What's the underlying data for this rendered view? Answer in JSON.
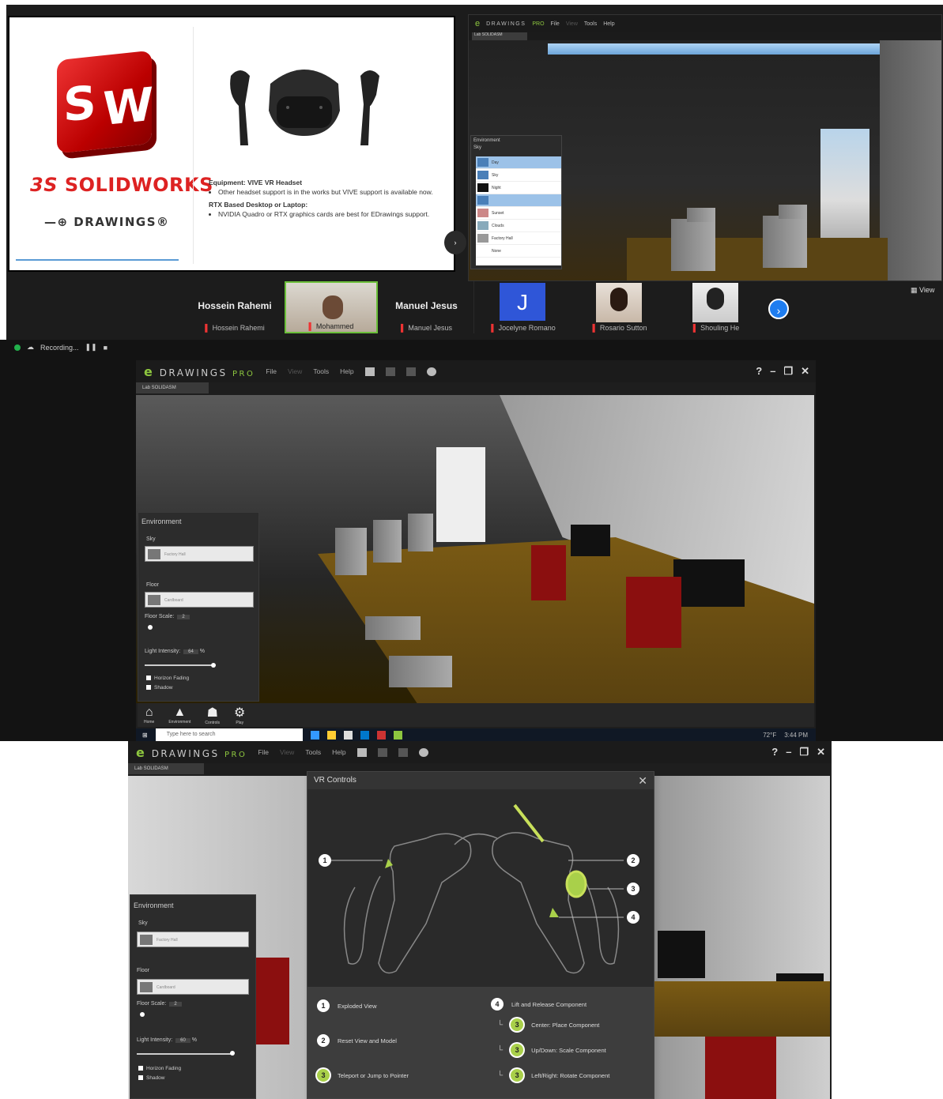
{
  "slide": {
    "sw_letters": [
      "S",
      "W"
    ],
    "brand": "SOLIDWORKS",
    "brand_prefix": "3S",
    "edrawings": "DRAWINGS",
    "equipment_title": "Equipment: VIVE VR Headset",
    "equipment_bullet": "Other headset support is in the works but VIVE support is available now.",
    "rtx_title": "RTX Based Desktop or Laptop:",
    "rtx_bullet": "NVIDIA Quadro or RTX graphics cards are best for EDrawings support.",
    "next_label": "›"
  },
  "participants": [
    {
      "big": "Hossein Rahemi",
      "small": "Hossein Rahemi"
    },
    {
      "big": "",
      "small": "Mohammed"
    },
    {
      "big": "Manuel Jesus",
      "small": "Manuel Jesus"
    },
    {
      "big": "",
      "small": "Jocelyne Romano",
      "initial": "J"
    },
    {
      "big": "",
      "small": "Rosario Sutton"
    },
    {
      "big": "",
      "small": "Shouling He"
    }
  ],
  "strip": {
    "view_label": "View",
    "next_icon": "›"
  },
  "recording": {
    "label": "Recording..."
  },
  "app": {
    "brand_e": "e",
    "brand": "DRAWINGS",
    "brand_pro": "PRO",
    "menu": [
      "File",
      "View",
      "Tools",
      "Help"
    ],
    "help": "?",
    "min": "–",
    "restore": "❐",
    "close": "✕",
    "doc_tab": "Lab SOLIDASM"
  },
  "environment": {
    "title": "Environment",
    "sky_label": "Sky",
    "sky_value": "Factory Hall",
    "floor_label": "Floor",
    "floor_value": "Cardboard",
    "floor_scale_label": "Floor Scale:",
    "floor_scale": "2",
    "light_label": "Light Intensity:",
    "light_value": "64",
    "light_value_b": "60",
    "percent": "%",
    "horizon": "Horizon Fading",
    "shadow": "Shadow"
  },
  "env_popup": {
    "title": "Environment",
    "sky_label": "Sky",
    "items": [
      "Day",
      "Sky",
      "Night",
      "",
      "Sunset",
      "Clouds",
      "Factory Hall",
      "None"
    ]
  },
  "dock": [
    {
      "icon": "⌂",
      "label": "Home"
    },
    {
      "icon": "▲",
      "label": "Environment"
    },
    {
      "icon": "☗",
      "label": "Controls"
    },
    {
      "icon": "⚙",
      "label": "Play"
    }
  ],
  "taskbar": {
    "search": "Type here to search",
    "weather": "72°F",
    "time": "3:44 PM"
  },
  "vr": {
    "title": "VR Controls",
    "close": "✕",
    "callouts": [
      "1",
      "2",
      "3",
      "4"
    ],
    "items": [
      {
        "n": "1",
        "label": "Exploded View"
      },
      {
        "n": "2",
        "label": "Reset View and Model"
      },
      {
        "n": "3",
        "label": "Teleport or Jump to Pointer"
      },
      {
        "n": "4",
        "label": "Lift and Release Component"
      },
      {
        "n": "3",
        "label": "Center: Place Component"
      },
      {
        "n": "3",
        "label": "Up/Down: Scale Component"
      },
      {
        "n": "3",
        "label": "Left/Right: Rotate Component"
      }
    ]
  },
  "colors": {
    "accent": "#8dc63f",
    "sw_red": "#d22222",
    "zoom_blue": "#1e7df0"
  }
}
